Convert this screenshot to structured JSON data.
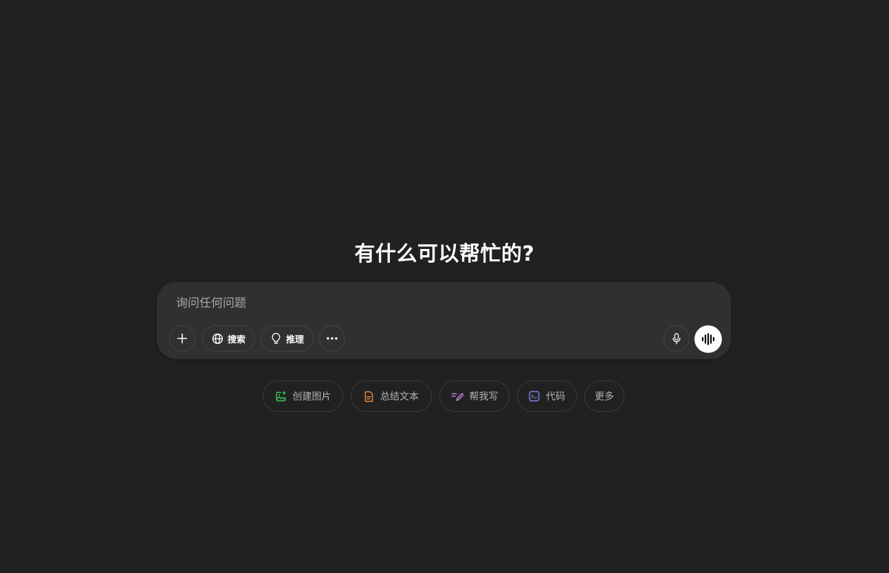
{
  "heading": "有什么可以帮忙的?",
  "composer": {
    "placeholder": "询问任何问题",
    "value": "",
    "tools": {
      "add_icon": "plus-icon",
      "search_label": "搜索",
      "search_icon": "globe-icon",
      "reason_label": "推理",
      "reason_icon": "lightbulb-icon",
      "more_icon": "ellipsis-icon",
      "mic_icon": "microphone-icon",
      "voice_icon": "voice-waveform-icon"
    }
  },
  "suggestions": [
    {
      "label": "创建图片",
      "icon": "image-icon",
      "color": "#35c759"
    },
    {
      "label": "总结文本",
      "icon": "document-icon",
      "color": "#e8863a"
    },
    {
      "label": "帮我写",
      "icon": "pen-icon",
      "color": "#c67ed6"
    },
    {
      "label": "代码",
      "icon": "terminal-icon",
      "color": "#7b7bdc"
    },
    {
      "label": "更多",
      "icon": "",
      "color": ""
    }
  ],
  "colors": {
    "background": "#212121",
    "composer": "#303030",
    "text": "#ececec",
    "muted": "#b4b4b4"
  }
}
